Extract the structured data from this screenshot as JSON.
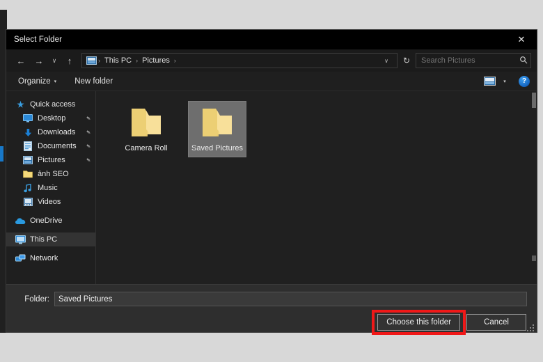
{
  "dialog": {
    "title": "Select Folder",
    "close_label": "✕"
  },
  "nav": {
    "back_label": "←",
    "forward_label": "→",
    "recent_label": "∨",
    "up_label": "↑",
    "refresh_label": "↻",
    "breadcrumb_chevron": "∨",
    "separator": "›",
    "crumbs": [
      {
        "label": "This PC"
      },
      {
        "label": "Pictures"
      }
    ]
  },
  "search": {
    "placeholder": "Search Pictures",
    "value": "",
    "icon": "⚲"
  },
  "toolbar": {
    "organize_label": "Organize",
    "organize_caret": "▾",
    "new_folder_label": "New folder",
    "view_caret": "▾",
    "help_label": "?"
  },
  "sidebar": {
    "items": [
      {
        "label": "Quick access",
        "icon": "star-icon",
        "indent": false,
        "pinned": false,
        "selected": false
      },
      {
        "label": "Desktop",
        "icon": "desktop-icon",
        "indent": true,
        "pinned": true,
        "selected": false
      },
      {
        "label": "Downloads",
        "icon": "downloads-icon",
        "indent": true,
        "pinned": true,
        "selected": false
      },
      {
        "label": "Documents",
        "icon": "documents-icon",
        "indent": true,
        "pinned": true,
        "selected": false
      },
      {
        "label": "Pictures",
        "icon": "pictures-icon",
        "indent": true,
        "pinned": true,
        "selected": false
      },
      {
        "label": "ảnh SEO",
        "icon": "folder-icon",
        "indent": true,
        "pinned": false,
        "selected": false
      },
      {
        "label": "Music",
        "icon": "music-icon",
        "indent": true,
        "pinned": false,
        "selected": false
      },
      {
        "label": "Videos",
        "icon": "videos-icon",
        "indent": true,
        "pinned": false,
        "selected": false
      },
      {
        "label": "OneDrive",
        "icon": "onedrive-icon",
        "indent": false,
        "pinned": false,
        "selected": false
      },
      {
        "label": "This PC",
        "icon": "thispc-icon",
        "indent": false,
        "pinned": false,
        "selected": true
      },
      {
        "label": "Network",
        "icon": "network-icon",
        "indent": false,
        "pinned": false,
        "selected": false
      }
    ],
    "pin_glyph": "✒"
  },
  "content": {
    "folders": [
      {
        "name": "Camera Roll",
        "selected": false
      },
      {
        "name": "Saved Pictures",
        "selected": true
      }
    ]
  },
  "footer": {
    "folder_label": "Folder:",
    "folder_value": "Saved Pictures",
    "choose_label": "Choose this folder",
    "cancel_label": "Cancel"
  },
  "colors": {
    "highlight_red": "#f01818",
    "selection_gray": "#6e6e6e",
    "folder_yellow": "#f5d97a",
    "accent_blue": "#1878c8"
  }
}
